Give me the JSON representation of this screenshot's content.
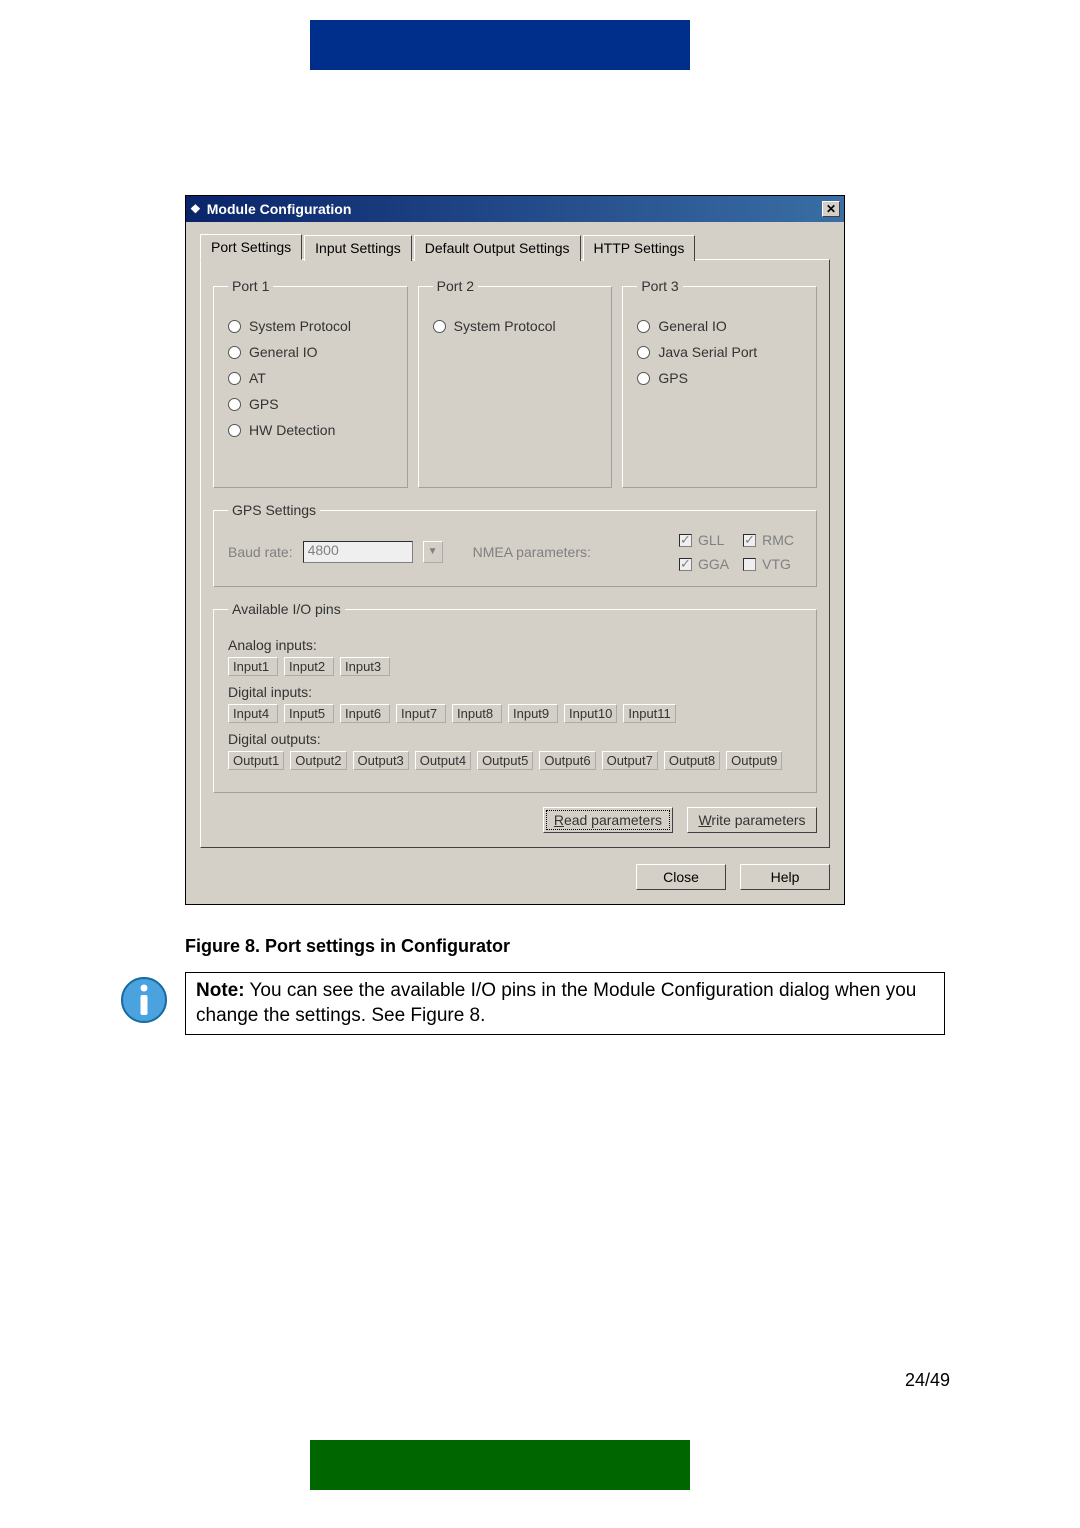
{
  "page_number": "24/49",
  "caption": "Figure 8. Port settings in Configurator",
  "note": {
    "label": "Note:",
    "text": " You can see the available I/O pins in the Module Configuration dialog when you change the settings. See Figure 8."
  },
  "dialog": {
    "title": "Module Configuration",
    "tabs": [
      "Port Settings",
      "Input Settings",
      "Default Output Settings",
      "HTTP Settings"
    ],
    "port1": {
      "legend": "Port 1",
      "options": [
        "System Protocol",
        "General IO",
        "AT",
        "GPS",
        "HW Detection"
      ]
    },
    "port2": {
      "legend": "Port 2",
      "options": [
        "System Protocol"
      ]
    },
    "port3": {
      "legend": "Port 3",
      "options": [
        "General IO",
        "Java Serial Port",
        "GPS"
      ]
    },
    "gps": {
      "legend": "GPS Settings",
      "baud_label": "Baud rate:",
      "baud_value": "4800",
      "nmea_label": "NMEA parameters:",
      "params": [
        {
          "label": "GLL",
          "checked": true
        },
        {
          "label": "RMC",
          "checked": true
        },
        {
          "label": "GGA",
          "checked": true
        },
        {
          "label": "VTG",
          "checked": false
        }
      ]
    },
    "io": {
      "legend": "Available I/O pins",
      "analog_label": "Analog inputs:",
      "analog": [
        "Input1",
        "Input2",
        "Input3"
      ],
      "digital_in_label": "Digital inputs:",
      "digital_in": [
        "Input4",
        "Input5",
        "Input6",
        "Input7",
        "Input8",
        "Input9",
        "Input10",
        "Input11"
      ],
      "digital_out_label": "Digital outputs:",
      "digital_out": [
        "Output1",
        "Output2",
        "Output3",
        "Output4",
        "Output5",
        "Output6",
        "Output7",
        "Output8",
        "Output9"
      ]
    },
    "buttons": {
      "read": "Read parameters",
      "write": "Write parameters",
      "close": "Close",
      "help": "Help"
    }
  }
}
